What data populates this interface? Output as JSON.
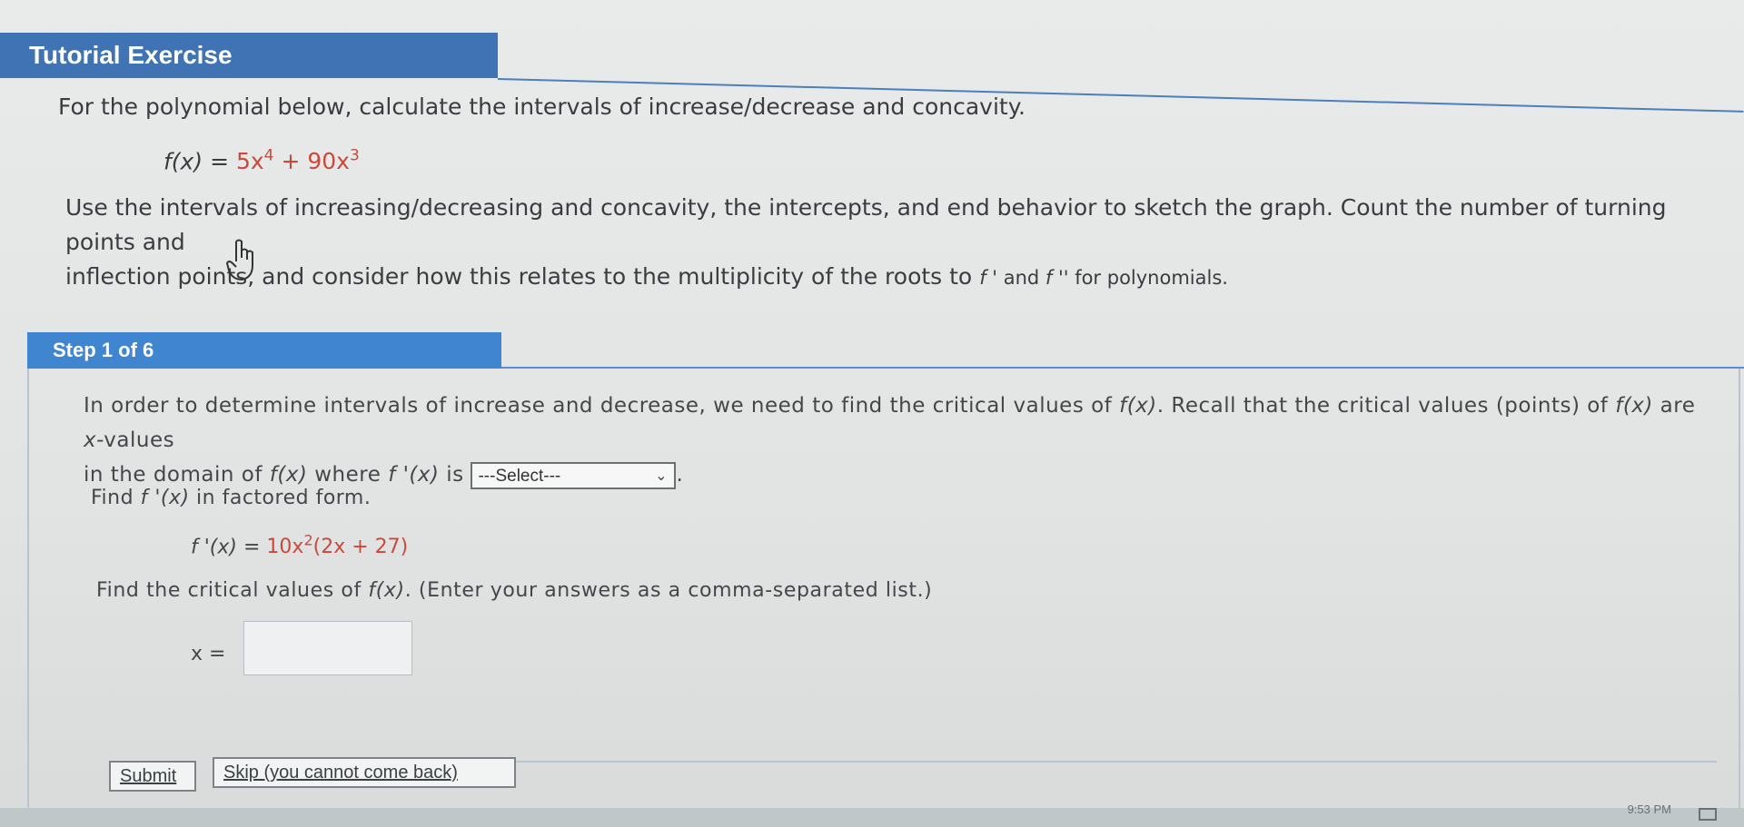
{
  "header": {
    "title": "Tutorial Exercise"
  },
  "problem": {
    "intro": "For the polynomial below, calculate the intervals of increase/decrease and concavity.",
    "function_lhs": "f(x)",
    "function_eq": "=",
    "function_term1_base": "5x",
    "function_term1_exp": "4",
    "function_plus": "+",
    "function_term2_base": "90x",
    "function_term2_exp": "3",
    "instructions_part1": "Use the intervals of increasing/decreasing and concavity, the intercepts, and end behavior to sketch the graph. Count the number of turning points and",
    "instructions_part2": "inflection points, and consider how this relates to the multiplicity of the roots to ",
    "instructions_fprime": "f '",
    "instructions_and": " and ",
    "instructions_fdprime": "f ''",
    "instructions_end": " for polynomials."
  },
  "step": {
    "label": "Step 1 of 6",
    "para1_a": "In order to determine intervals of increase and decrease, we need to find the critical values of ",
    "para1_fx": "f(x)",
    "para1_b": ". Recall that the critical values (points) of ",
    "para1_fx2": "f(x)",
    "para1_c": " are ",
    "para1_xvalues": "x",
    "para1_d": "-values",
    "para1_e": "in the domain of ",
    "para1_fx3": "f(x)",
    "para1_f": " where ",
    "para1_fprime": "f '(x)",
    "para1_g": " is ",
    "select_value": "---Select---",
    "para1_end": ".",
    "find_fprime_a": "Find ",
    "find_fprime_f": "f '(x)",
    "find_fprime_b": " in factored form.",
    "fprime_lhs": "f '(x)",
    "fprime_eq": "=",
    "fprime_rhs_a": "10x",
    "fprime_rhs_exp": "2",
    "fprime_rhs_b": "(2x + 27)",
    "find_critical_a": "Find the critical values of ",
    "find_critical_f": "f(x)",
    "find_critical_b": ". (Enter your answers as a comma-separated list.)",
    "x_label": "x =",
    "answer_value": ""
  },
  "buttons": {
    "submit": "Submit",
    "skip": "Skip (you cannot come back)"
  },
  "taskbar": {
    "clock": "9:53 PM"
  }
}
